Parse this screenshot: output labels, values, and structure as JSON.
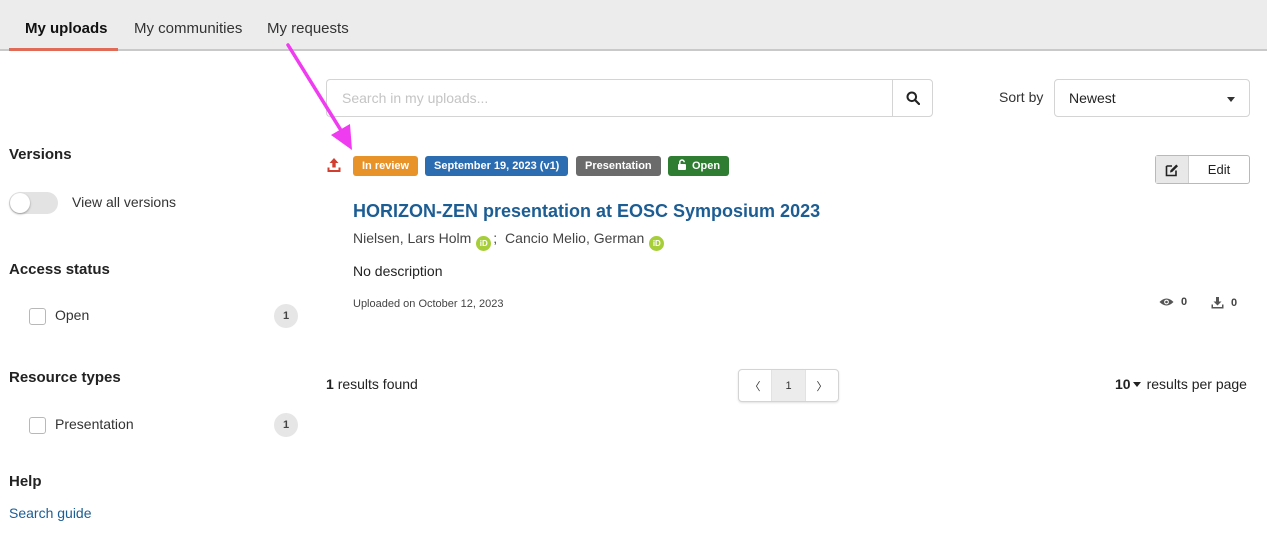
{
  "tabs": [
    {
      "label": "My uploads",
      "active": true
    },
    {
      "label": "My communities",
      "active": false
    },
    {
      "label": "My requests",
      "active": false
    }
  ],
  "sidebar": {
    "versions_heading": "Versions",
    "versions_toggle_label": "View all versions",
    "access_heading": "Access status",
    "access_items": [
      {
        "label": "Open",
        "count": "1"
      }
    ],
    "resource_heading": "Resource types",
    "resource_items": [
      {
        "label": "Presentation",
        "count": "1"
      }
    ],
    "help_heading": "Help",
    "help_link": "Search guide"
  },
  "search": {
    "placeholder": "Search in my uploads...",
    "sort_label": "Sort by",
    "sort_value": "Newest"
  },
  "record": {
    "status_label": "In review",
    "date_label": "September 19, 2023 (v1)",
    "type_label": "Presentation",
    "access_label": "Open",
    "title": "HORIZON-ZEN presentation at EOSC Symposium 2023",
    "creator_1": "Nielsen, Lars Holm",
    "creator_sep": ";",
    "creator_2": "Cancio Melio, German",
    "orcid_badge": "iD",
    "description": "No description",
    "uploaded": "Uploaded on October 12, 2023",
    "views": "0",
    "downloads": "0",
    "edit_label": "Edit"
  },
  "results": {
    "found_count": "1",
    "found_text": "results found",
    "prev_glyph": "〈",
    "current_page": "1",
    "next_glyph": "〉",
    "per_page_value": "10",
    "per_page_text": "results per page"
  },
  "colors": {
    "in_review": "#e8922a",
    "date": "#2b6db0",
    "type": "#6b6b6b",
    "open": "#2e7d32",
    "title_link": "#1c5d93",
    "tab_underline": "#e06c57",
    "annotation_arrow": "#f03cf0"
  }
}
